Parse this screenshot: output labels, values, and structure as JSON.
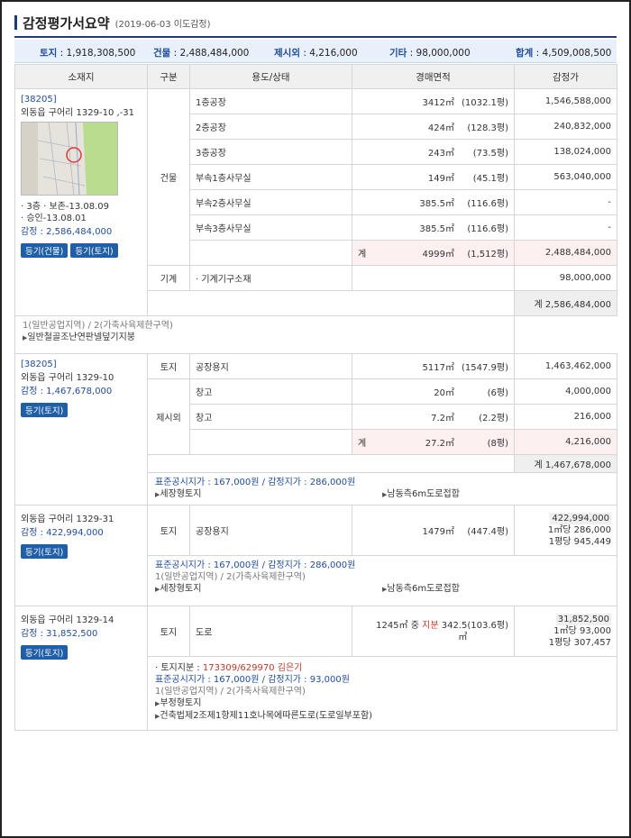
{
  "title": "감정평가서요약",
  "title_sub": "(2019-06-03  이도감정)",
  "summary": {
    "land_label": "토지",
    "land_value": "1,918,308,500",
    "building_label": "건물",
    "building_value": "2,488,484,000",
    "extra_label": "제시외",
    "extra_value": "4,216,000",
    "etc_label": "기타",
    "etc_value": "98,000,000",
    "total_label": "합계",
    "total_value": "4,509,008,500"
  },
  "headers": [
    "소재지",
    "구분",
    "용도/상태",
    "경매면적",
    "감정가"
  ],
  "props": [
    {
      "zip": "[38205]",
      "addr": "외동읍 구어리 1329-10 ,-31",
      "note1": "· 3층  · 보존-13.08.09",
      "note2": "· 승인-13.08.01",
      "appraisal": "감정 : 2,586,484,000",
      "btn1": "등기(건물)",
      "btn2": "등기(토지)",
      "cat_building": "건물",
      "rows": [
        {
          "use": "1층공장",
          "area": "3412㎡",
          "pyeong": "(1032.1평)",
          "price": "1,546,588,000"
        },
        {
          "use": "2층공장",
          "area": "424㎡",
          "pyeong": "(128.3평)",
          "price": "240,832,000"
        },
        {
          "use": "3층공장",
          "area": "243㎡",
          "pyeong": "(73.5평)",
          "price": "138,024,000"
        },
        {
          "use": "부속1층사무실",
          "area": "149㎡",
          "pyeong": "(45.1평)",
          "price": "563,040,000"
        },
        {
          "use": "부속2층사무실",
          "area": "385.5㎡",
          "pyeong": "(116.6평)",
          "price": "-"
        },
        {
          "use": "부속3층사무실",
          "area": "385.5㎡",
          "pyeong": "(116.6평)",
          "price": "-"
        }
      ],
      "sum_label": "계",
      "sum_area": "4999㎡",
      "sum_pyeong": "(1,512평)",
      "sum_price": "2,488,484,000",
      "cat_machine": "기계",
      "machine_use": "· 기계기구소재",
      "machine_price": "98,000,000",
      "total": "계 2,586,484,000",
      "zone": "1(일반공업지역) / 2(가축사육제한구역)",
      "feature": "일반철골조난연판넬덮기지붕"
    },
    {
      "zip": "[38205]",
      "addr": "외동읍 구어리 1329-10",
      "appraisal": "감정 : 1,467,678,000",
      "btn1": "등기(토지)",
      "cat_land": "토지",
      "land_use": "공장용지",
      "land_area": "5117㎡",
      "land_pyeong": "(1547.9평)",
      "land_price": "1,463,462,000",
      "cat_extra": "제시외",
      "rows": [
        {
          "use": "창고",
          "area": "20㎡",
          "pyeong": "(6평)",
          "price": "4,000,000"
        },
        {
          "use": "창고",
          "area": "7.2㎡",
          "pyeong": "(2.2평)",
          "price": "216,000"
        }
      ],
      "sum_label": "계",
      "sum_area": "27.2㎡",
      "sum_pyeong": "(8평)",
      "sum_price": "4,216,000",
      "total": "계 1,467,678,000",
      "official": "표준공시지가 : 167,000원 / 감정지가 : 286,000원",
      "feature1": "세장형토지",
      "feature2": "남동측6m도로접합"
    },
    {
      "addr": "외동읍 구어리 1329-31",
      "appraisal": "감정 : 422,994,000",
      "btn1": "등기(토지)",
      "cat": "토지",
      "use": "공장용지",
      "area": "1479㎡",
      "pyeong": "(447.4평)",
      "price": "422,994,000",
      "per_m2": "1㎡당 286,000",
      "per_py": "1평당 945,449",
      "official": "표준공시지가 : 167,000원 / 감정지가 : 286,000원",
      "zone": "1(일반공업지역) / 2(가축사육제한구역)",
      "feature1": "세장형토지",
      "feature2": "남동측6m도로접합"
    },
    {
      "addr": "외동읍 구어리 1329-14",
      "appraisal": "감정 : 31,852,500",
      "btn1": "등기(토지)",
      "cat": "토지",
      "use": "도로",
      "area_total": "1245㎡",
      "area_mid": "중",
      "area_share_label": "지분",
      "area_share": "342.5",
      "area_unit": "㎡",
      "pyeong": "(103.6평)",
      "price": "31,852,500",
      "per_m2": "1㎡당 93,000",
      "per_py": "1평당 307,457",
      "share_label": "· 토지지분 : ",
      "share_value": "173309/629970 김은기",
      "official": "표준공시지가 : 167,000원 / 감정지가 : 93,000원",
      "zone": "1(일반공업지역) / 2(가축사육제한구역)",
      "feature1": "부정형토지",
      "feature2": "건축법제2조제1항제11호나목에따른도로(도로일부포함)"
    }
  ],
  "colors": {
    "accent": "#1f4c9c",
    "button": "#1f5fa8",
    "header_bg": "#f0f0f0",
    "summary_bg": "#e8f0fb",
    "share_red": "#c0392b"
  }
}
